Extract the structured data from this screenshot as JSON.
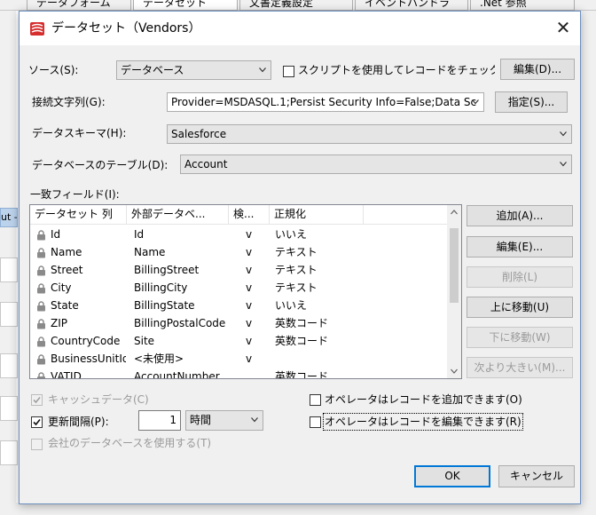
{
  "background": {
    "tabs": [
      "データフォーム",
      "データセット",
      "文書定義設定",
      "イベントハンドラ",
      ".Net 参照"
    ],
    "left_label": "ut -"
  },
  "dialog": {
    "title": "データセット（Vendors）",
    "close_glyph": "✕",
    "source": {
      "label": "ソース(S):",
      "value": "データベース"
    },
    "script_check": {
      "label": "スクリプトを使用してレコードをチェック(I",
      "checked": false
    },
    "edit_button": "編集(D)...",
    "connection": {
      "label": "接続文字列(G):",
      "value": "Provider=MSDASQL.1;Persist Security Info=False;Data Sc"
    },
    "specify_button": "指定(S)...",
    "schema": {
      "label": "データスキーマ(H):",
      "value": "Salesforce"
    },
    "table": {
      "label": "データベースのテーブル(D):",
      "value": "Account"
    },
    "match_fields": {
      "label": "一致フィールド(I):",
      "columns": [
        "データセット 列",
        "外部データベ...",
        "検...",
        "正規化"
      ],
      "rows": [
        {
          "field": "Id",
          "external": "Id",
          "check": "v",
          "normalize": "いいえ"
        },
        {
          "field": "Name",
          "external": "Name",
          "check": "v",
          "normalize": "テキスト"
        },
        {
          "field": "Street",
          "external": "BillingStreet",
          "check": "v",
          "normalize": "テキスト"
        },
        {
          "field": "City",
          "external": "BillingCity",
          "check": "v",
          "normalize": "テキスト"
        },
        {
          "field": "State",
          "external": "BillingState",
          "check": "v",
          "normalize": "いいえ"
        },
        {
          "field": "ZIP",
          "external": "BillingPostalCode",
          "check": "v",
          "normalize": "英数コード"
        },
        {
          "field": "CountryCode",
          "external": "Site",
          "check": "v",
          "normalize": "英数コード"
        },
        {
          "field": "BusinessUnitId",
          "external": "<未使用>",
          "check": "v",
          "normalize": ""
        },
        {
          "field": "VATID",
          "external": "AccountNumber",
          "check": "",
          "normalize": "英数コード"
        }
      ]
    },
    "side_buttons": {
      "add": "追加(A)...",
      "edit": "編集(E)...",
      "delete": "削除(L)",
      "move_up": "上に移動(U)",
      "move_down": "下に移動(W)",
      "next_larger": "次より大きい(M)..."
    },
    "options": {
      "cache": {
        "label": "キャッシュデータ(C)",
        "checked": true,
        "enabled": false
      },
      "update_interval": {
        "label": "更新間隔(P):",
        "checked": true,
        "value": "1",
        "unit": "時間"
      },
      "use_company_db": {
        "label": "会社のデータベースを使用する(T)",
        "checked": false,
        "enabled": false
      },
      "operator_add": {
        "label": "オペレータはレコードを追加できます(O)",
        "checked": false
      },
      "operator_edit": {
        "label": "オペレータはレコードを編集できます(R)",
        "checked": false
      }
    },
    "ok_button": "OK",
    "cancel_button": "キャンセル",
    "colors": {
      "accent": "#0078d7",
      "title_icon": "#d62d2d"
    },
    "icons": {
      "row": "lock-icon",
      "combo": "chevron-down-icon",
      "title": "dataset-icon"
    }
  }
}
